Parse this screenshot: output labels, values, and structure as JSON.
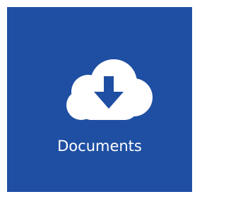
{
  "tile": {
    "label": "Documents",
    "icon": "cloud-download-icon",
    "background_color": "#1f4fa3",
    "foreground_color": "#ffffff"
  }
}
